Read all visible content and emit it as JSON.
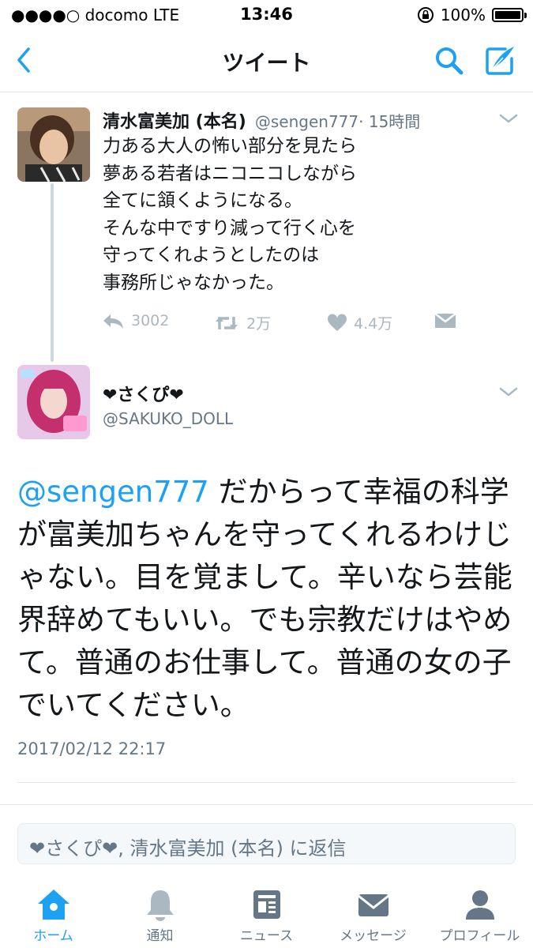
{
  "status_bar": {
    "carrier": "●●●●○ docomo  LTE",
    "time": "13:46",
    "battery": "100%"
  },
  "nav": {
    "title": "ツイート",
    "back_icon": "chevron-left-icon",
    "search_icon": "search-icon",
    "compose_icon": "compose-icon"
  },
  "tweet1": {
    "name": "清水富美加 (本名)",
    "handle": "@sengen777",
    "time": "· 15時間",
    "text": "力ある大人の怖い部分を見たら\n夢ある若者はニコニコしながら\n全てに頷くようになる。\nそんな中ですり減って行く心を\n守ってくれようとしたのは\n事務所じゃなかった。",
    "replies": "3002",
    "retweets": "2万",
    "likes": "4.4万"
  },
  "tweet2": {
    "name": "❤さくぴ❤",
    "handle": "@SAKUKO_DOLL",
    "mention": "@sengen777",
    "text": " だからって幸福の科学が富美加ちゃんを守ってくれるわけじゃない。目を覚まして。辛いなら芸能界辞めてもいい。でも宗教だけはやめて。普通のお仕事して。普通の女の子でいてください。",
    "date": "2017/02/12 22:17"
  },
  "reply": {
    "placeholder": "❤さくぴ❤, 清水富美加 (本名) に返信"
  },
  "tabs": [
    {
      "label": "ホーム",
      "icon": "home-icon",
      "active": true
    },
    {
      "label": "通知",
      "icon": "bell-icon",
      "active": false
    },
    {
      "label": "ニュース",
      "icon": "news-icon",
      "active": false
    },
    {
      "label": "メッセージ",
      "icon": "envelope-icon",
      "active": false
    },
    {
      "label": "プロフィール",
      "icon": "profile-icon",
      "active": false
    }
  ],
  "colors": {
    "accent": "#1da1f2",
    "text": "#14171a",
    "muted": "#657786",
    "icon_muted": "#aab8c2"
  }
}
